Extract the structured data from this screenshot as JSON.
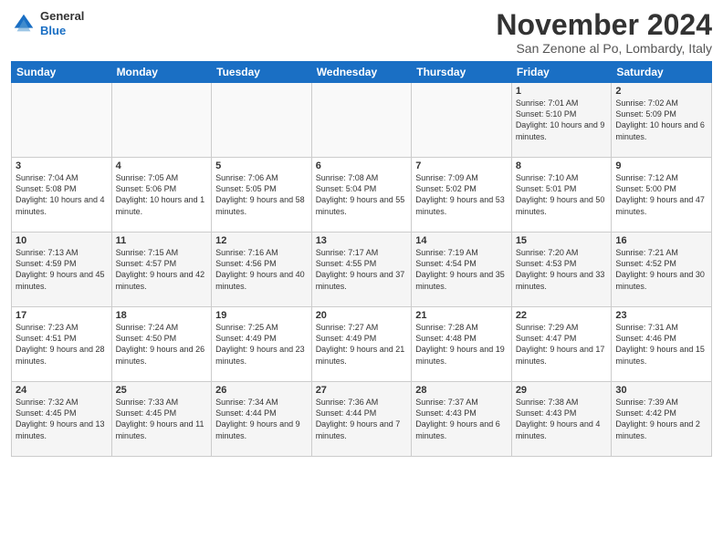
{
  "header": {
    "logo_line1": "General",
    "logo_line2": "Blue",
    "month": "November 2024",
    "location": "San Zenone al Po, Lombardy, Italy"
  },
  "days_of_week": [
    "Sunday",
    "Monday",
    "Tuesday",
    "Wednesday",
    "Thursday",
    "Friday",
    "Saturday"
  ],
  "weeks": [
    [
      {
        "day": "",
        "info": ""
      },
      {
        "day": "",
        "info": ""
      },
      {
        "day": "",
        "info": ""
      },
      {
        "day": "",
        "info": ""
      },
      {
        "day": "",
        "info": ""
      },
      {
        "day": "1",
        "info": "Sunrise: 7:01 AM\nSunset: 5:10 PM\nDaylight: 10 hours and 9 minutes."
      },
      {
        "day": "2",
        "info": "Sunrise: 7:02 AM\nSunset: 5:09 PM\nDaylight: 10 hours and 6 minutes."
      }
    ],
    [
      {
        "day": "3",
        "info": "Sunrise: 7:04 AM\nSunset: 5:08 PM\nDaylight: 10 hours and 4 minutes."
      },
      {
        "day": "4",
        "info": "Sunrise: 7:05 AM\nSunset: 5:06 PM\nDaylight: 10 hours and 1 minute."
      },
      {
        "day": "5",
        "info": "Sunrise: 7:06 AM\nSunset: 5:05 PM\nDaylight: 9 hours and 58 minutes."
      },
      {
        "day": "6",
        "info": "Sunrise: 7:08 AM\nSunset: 5:04 PM\nDaylight: 9 hours and 55 minutes."
      },
      {
        "day": "7",
        "info": "Sunrise: 7:09 AM\nSunset: 5:02 PM\nDaylight: 9 hours and 53 minutes."
      },
      {
        "day": "8",
        "info": "Sunrise: 7:10 AM\nSunset: 5:01 PM\nDaylight: 9 hours and 50 minutes."
      },
      {
        "day": "9",
        "info": "Sunrise: 7:12 AM\nSunset: 5:00 PM\nDaylight: 9 hours and 47 minutes."
      }
    ],
    [
      {
        "day": "10",
        "info": "Sunrise: 7:13 AM\nSunset: 4:59 PM\nDaylight: 9 hours and 45 minutes."
      },
      {
        "day": "11",
        "info": "Sunrise: 7:15 AM\nSunset: 4:57 PM\nDaylight: 9 hours and 42 minutes."
      },
      {
        "day": "12",
        "info": "Sunrise: 7:16 AM\nSunset: 4:56 PM\nDaylight: 9 hours and 40 minutes."
      },
      {
        "day": "13",
        "info": "Sunrise: 7:17 AM\nSunset: 4:55 PM\nDaylight: 9 hours and 37 minutes."
      },
      {
        "day": "14",
        "info": "Sunrise: 7:19 AM\nSunset: 4:54 PM\nDaylight: 9 hours and 35 minutes."
      },
      {
        "day": "15",
        "info": "Sunrise: 7:20 AM\nSunset: 4:53 PM\nDaylight: 9 hours and 33 minutes."
      },
      {
        "day": "16",
        "info": "Sunrise: 7:21 AM\nSunset: 4:52 PM\nDaylight: 9 hours and 30 minutes."
      }
    ],
    [
      {
        "day": "17",
        "info": "Sunrise: 7:23 AM\nSunset: 4:51 PM\nDaylight: 9 hours and 28 minutes."
      },
      {
        "day": "18",
        "info": "Sunrise: 7:24 AM\nSunset: 4:50 PM\nDaylight: 9 hours and 26 minutes."
      },
      {
        "day": "19",
        "info": "Sunrise: 7:25 AM\nSunset: 4:49 PM\nDaylight: 9 hours and 23 minutes."
      },
      {
        "day": "20",
        "info": "Sunrise: 7:27 AM\nSunset: 4:49 PM\nDaylight: 9 hours and 21 minutes."
      },
      {
        "day": "21",
        "info": "Sunrise: 7:28 AM\nSunset: 4:48 PM\nDaylight: 9 hours and 19 minutes."
      },
      {
        "day": "22",
        "info": "Sunrise: 7:29 AM\nSunset: 4:47 PM\nDaylight: 9 hours and 17 minutes."
      },
      {
        "day": "23",
        "info": "Sunrise: 7:31 AM\nSunset: 4:46 PM\nDaylight: 9 hours and 15 minutes."
      }
    ],
    [
      {
        "day": "24",
        "info": "Sunrise: 7:32 AM\nSunset: 4:45 PM\nDaylight: 9 hours and 13 minutes."
      },
      {
        "day": "25",
        "info": "Sunrise: 7:33 AM\nSunset: 4:45 PM\nDaylight: 9 hours and 11 minutes."
      },
      {
        "day": "26",
        "info": "Sunrise: 7:34 AM\nSunset: 4:44 PM\nDaylight: 9 hours and 9 minutes."
      },
      {
        "day": "27",
        "info": "Sunrise: 7:36 AM\nSunset: 4:44 PM\nDaylight: 9 hours and 7 minutes."
      },
      {
        "day": "28",
        "info": "Sunrise: 7:37 AM\nSunset: 4:43 PM\nDaylight: 9 hours and 6 minutes."
      },
      {
        "day": "29",
        "info": "Sunrise: 7:38 AM\nSunset: 4:43 PM\nDaylight: 9 hours and 4 minutes."
      },
      {
        "day": "30",
        "info": "Sunrise: 7:39 AM\nSunset: 4:42 PM\nDaylight: 9 hours and 2 minutes."
      }
    ]
  ]
}
